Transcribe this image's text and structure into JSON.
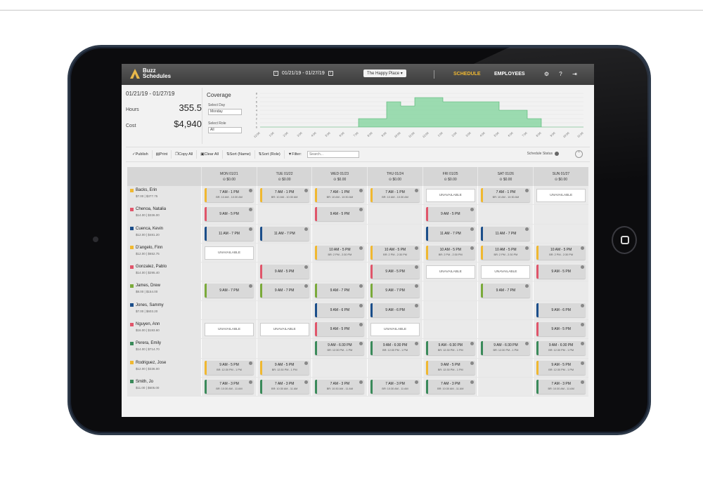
{
  "app": {
    "logo_text": "Buzz\nSchedules",
    "date_range": "01/21/19 - 01/27/19",
    "location": "The Happy Place",
    "nav": {
      "schedule": "SCHEDULE",
      "employees": "EMPLOYEES"
    },
    "icons": [
      "gear-icon",
      "help-icon",
      "logout-icon"
    ]
  },
  "summary": {
    "range": "01/21/19 - 01/27/19",
    "hours_label": "Hours",
    "hours_value": "355.5",
    "cost_label": "Cost",
    "cost_value": "$4,940"
  },
  "coverage": {
    "title": "Coverage",
    "select_day_label": "Select Day",
    "select_day_value": "Monday",
    "select_role_label": "Select Role",
    "select_role_value": "All"
  },
  "chart_data": {
    "type": "area",
    "title": "Coverage",
    "y_ticks": [
      "0",
      "1",
      "2",
      "3",
      "4",
      "5",
      "6",
      "7",
      "8"
    ],
    "ylim": [
      0,
      8
    ],
    "x_labels": [
      "12:00",
      "1:00",
      "2:00",
      "3:00",
      "4:00",
      "5:00",
      "6:00",
      "7:00",
      "8:00",
      "9:00",
      "10:00",
      "11:00",
      "12:00",
      "1:00",
      "2:00",
      "3:00",
      "4:00",
      "5:00",
      "6:00",
      "7:00",
      "8:00",
      "9:00",
      "10:00",
      "11:00"
    ],
    "values": [
      0,
      0,
      0,
      0,
      0,
      0,
      0,
      2,
      2,
      6,
      5,
      7,
      7,
      6,
      6,
      6,
      6,
      4,
      4,
      2,
      0,
      0,
      0,
      0
    ],
    "grid": true,
    "color": "#7ed39a"
  },
  "toolbar": {
    "publish": "Publish",
    "print": "Print",
    "copy_all": "Copy All",
    "clear_all": "Clear All",
    "sort_name": "Sort (Name)",
    "sort_role": "Sort (Role)",
    "filter": "Filter:",
    "filter_placeholder": "Search...",
    "schedule_status": "Schedule Status"
  },
  "days": [
    {
      "label": "MON 01/21",
      "sub": "$0.00"
    },
    {
      "label": "TUE 01/22",
      "sub": "$0.00"
    },
    {
      "label": "WED 01/23",
      "sub": "$0.00"
    },
    {
      "label": "THU 01/24",
      "sub": "$0.00"
    },
    {
      "label": "FRI 01/25",
      "sub": "$0.00"
    },
    {
      "label": "SAT 01/26",
      "sub": "$0.00"
    },
    {
      "label": "SUN 01/27",
      "sub": "$0.00"
    }
  ],
  "employees": [
    {
      "name": "Backs, Erin",
      "meta": "$7.00  |  $377.75",
      "color": "#f0b830",
      "cells": [
        {
          "t": "7 AM - 1 PM",
          "s": "BR: 10 AM - 10:30 AM"
        },
        {
          "t": "7 AM - 1 PM",
          "s": "BR: 10 AM - 10:30 AM"
        },
        {
          "t": "7 AM - 1 PM",
          "s": "BR: 10 AM - 10:30 AM"
        },
        {
          "t": "7 AM - 1 PM",
          "s": "BR: 10 AM - 10:30 AM"
        },
        {
          "u": "UNAVAILABLE"
        },
        {
          "t": "7 AM - 1 PM",
          "s": "BR: 10 AM - 10:30 AM"
        },
        {
          "u": "UNAVAILABLE"
        }
      ]
    },
    {
      "name": "Chenoa, Natalia",
      "meta": "$14.00  |  $336.00",
      "color": "#e0556a",
      "cells": [
        {
          "t": "9 AM - 5 PM"
        },
        {},
        {
          "t": "9 AM - 5 PM"
        },
        {},
        {
          "t": "9 AM - 5 PM"
        },
        {},
        {}
      ]
    },
    {
      "name": "Cuenca, Kevin",
      "meta": "$12.00  |  $481.20",
      "color": "#1b4e8a",
      "cells": [
        {
          "t": "11 AM - 7 PM"
        },
        {
          "t": "11 AM - 7 PM"
        },
        {},
        {},
        {
          "t": "11 AM - 7 PM"
        },
        {
          "t": "11 AM - 7 PM"
        },
        {}
      ]
    },
    {
      "name": "D'angelo, Finn",
      "meta": "$12.00  |  $652.75",
      "color": "#f0b830",
      "cells": [
        {
          "u": "UNAVAILABLE"
        },
        {},
        {
          "t": "10 AM - 5 PM",
          "s": "BR: 2 PM - 2:30 PM"
        },
        {
          "t": "10 AM - 5 PM",
          "s": "BR: 2 PM - 2:30 PM"
        },
        {
          "t": "10 AM - 5 PM",
          "s": "BR: 2 PM - 2:30 PM"
        },
        {
          "t": "10 AM - 5 PM",
          "s": "BR: 2 PM - 2:30 PM"
        },
        {
          "t": "10 AM - 5 PM",
          "s": "BR: 2 PM - 2:30 PM"
        }
      ]
    },
    {
      "name": "Gonzalez, Pablo",
      "meta": "$14.00  |  $295.40",
      "color": "#e0556a",
      "cells": [
        {},
        {
          "t": "9 AM - 5 PM"
        },
        {},
        {
          "t": "9 AM - 5 PM"
        },
        {
          "u": "UNAVAILABLE"
        },
        {
          "u": "UNAVAILABLE"
        },
        {
          "t": "9 AM - 5 PM"
        }
      ]
    },
    {
      "name": "James, Drew",
      "meta": "$8.00  |  $154.00",
      "color": "#7aaa3a",
      "cells": [
        {
          "t": "9 AM - 7 PM"
        },
        {
          "t": "9 AM - 7 PM"
        },
        {
          "t": "9 AM - 7 PM"
        },
        {
          "t": "9 AM - 7 PM"
        },
        {},
        {
          "t": "9 AM - 7 PM"
        },
        {}
      ]
    },
    {
      "name": "Jones, Sammy",
      "meta": "$7.00  |  $603.20",
      "color": "#1b4e8a",
      "cells": [
        {},
        {},
        {
          "t": "9 AM - 6 PM"
        },
        {
          "t": "9 AM - 6 PM"
        },
        {},
        {},
        {
          "t": "9 AM - 6 PM"
        }
      ]
    },
    {
      "name": "Nguyen, Ann",
      "meta": "$16.00  |  $193.60",
      "color": "#e0556a",
      "cells": [
        {
          "u": "UNAVAILABLE"
        },
        {
          "u": "UNAVAILABLE"
        },
        {
          "t": "9 AM - 5 PM"
        },
        {
          "u": "UNAVAILABLE"
        },
        {},
        {},
        {
          "t": "9 AM - 5 PM"
        }
      ]
    },
    {
      "name": "Perera, Emily",
      "meta": "$14.00  |  $714.70",
      "color": "#3a8a5a",
      "cells": [
        {},
        {},
        {
          "t": "9 AM - 6:30 PM",
          "s": "BR: 12:30 PM - 1 PM"
        },
        {
          "t": "9 AM - 6:30 PM",
          "s": "BR: 12:30 PM - 1 PM"
        },
        {
          "t": "9 AM - 6:30 PM",
          "s": "BR: 12:30 PM - 1 PM"
        },
        {
          "t": "9 AM - 6:30 PM",
          "s": "BR: 12:30 PM - 1 PM"
        },
        {
          "t": "9 AM - 6:30 PM",
          "s": "BR: 12:30 PM - 1 PM"
        }
      ]
    },
    {
      "name": "Rodriguez, Jose",
      "meta": "$12.00  |  $336.00",
      "color": "#f0b830",
      "cells": [
        {
          "t": "9 AM - 5 PM",
          "s": "BR: 12:30 PM - 1 PM"
        },
        {
          "t": "9 AM - 5 PM",
          "s": "BR: 12:30 PM - 1 PM"
        },
        {},
        {},
        {
          "t": "9 AM - 5 PM",
          "s": "BR: 12:30 PM - 1 PM"
        },
        {},
        {
          "t": "9 AM - 5 PM",
          "s": "BR: 12:30 PM - 1 PM"
        }
      ]
    },
    {
      "name": "Smith, Jo",
      "meta": "$11.00  |  $605.00",
      "color": "#3a8a5a",
      "cells": [
        {
          "t": "7 AM - 3 PM",
          "s": "BR: 10:30 AM - 11 AM"
        },
        {
          "t": "7 AM - 3 PM",
          "s": "BR: 10:30 AM - 11 AM"
        },
        {
          "t": "7 AM - 3 PM",
          "s": "BR: 10:30 AM - 11 AM"
        },
        {
          "t": "7 AM - 3 PM",
          "s": "BR: 10:30 AM - 11 AM"
        },
        {
          "t": "7 AM - 3 PM",
          "s": "BR: 10:30 AM - 11 AM"
        },
        {},
        {
          "t": "7 AM - 3 PM",
          "s": "BR: 10:30 AM - 11 AM"
        }
      ]
    }
  ]
}
